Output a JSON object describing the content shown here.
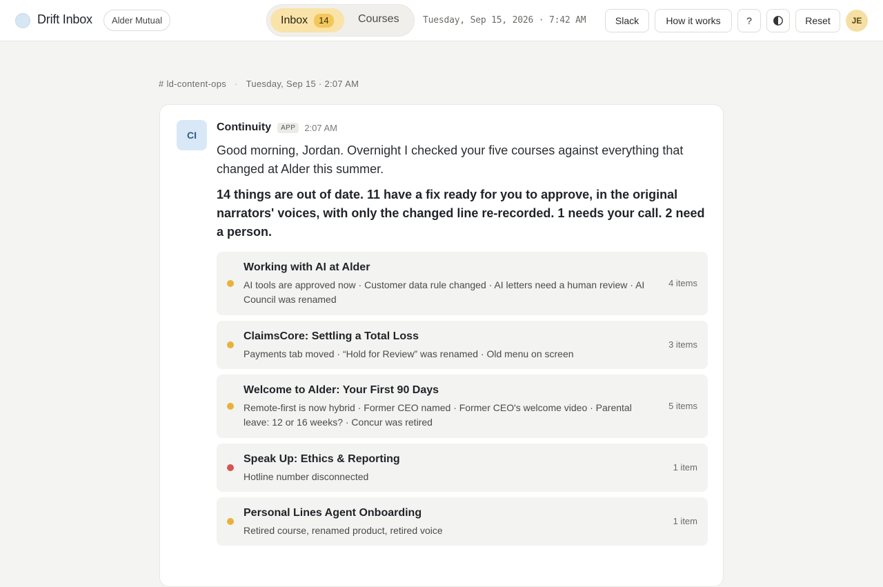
{
  "header": {
    "app_title": "Drift Inbox",
    "org": "Alder Mutual",
    "tabs": {
      "inbox_label": "Inbox",
      "inbox_count": "14",
      "courses_label": "Courses"
    },
    "clock": "Tuesday, Sep 15, 2026 · 7:42 AM",
    "buttons": {
      "slack": "Slack",
      "how": "How it works",
      "help": "?",
      "reset": "Reset"
    },
    "avatar_initials": "JE",
    "accent": "#f9e3a8"
  },
  "channel": {
    "name": "# ld-content-ops",
    "separator": "·",
    "timestamp": "Tuesday, Sep 15 · 2:07 AM"
  },
  "message": {
    "avatar_initials": "CI",
    "sender": "Continuity",
    "app_tag": "APP",
    "time": "2:07 AM",
    "intro": "Good morning, Jordan. Overnight I checked your five courses against everything that changed at Alder this summer.",
    "summary": "14 things are out of date. 11 have a fix ready for you to approve, in the original narrators' voices, with only the changed line re-recorded. 1 needs your call. 2 need a person."
  },
  "courses": [
    {
      "title": "Working with AI at Alder",
      "desc": "AI tools are approved now · Customer data rule changed · AI letters need a human review · AI Council was renamed",
      "count": "4 items",
      "status_color": "#e8b23a"
    },
    {
      "title": "ClaimsCore: Settling a Total Loss",
      "desc": "Payments tab moved · “Hold for Review” was renamed · Old menu on screen",
      "count": "3 items",
      "status_color": "#e8b23a"
    },
    {
      "title": "Welcome to Alder: Your First 90 Days",
      "desc": "Remote-first is now hybrid · Former CEO named · Former CEO's welcome video · Parental leave: 12 or 16 weeks? · Concur was retired",
      "count": "5 items",
      "status_color": "#e8b23a"
    },
    {
      "title": "Speak Up: Ethics & Reporting",
      "desc": "Hotline number disconnected",
      "count": "1 item",
      "status_color": "#d9534f"
    },
    {
      "title": "Personal Lines Agent Onboarding",
      "desc": "Retired course, renamed product, retired voice",
      "count": "1 item",
      "status_color": "#e8b23a"
    }
  ]
}
